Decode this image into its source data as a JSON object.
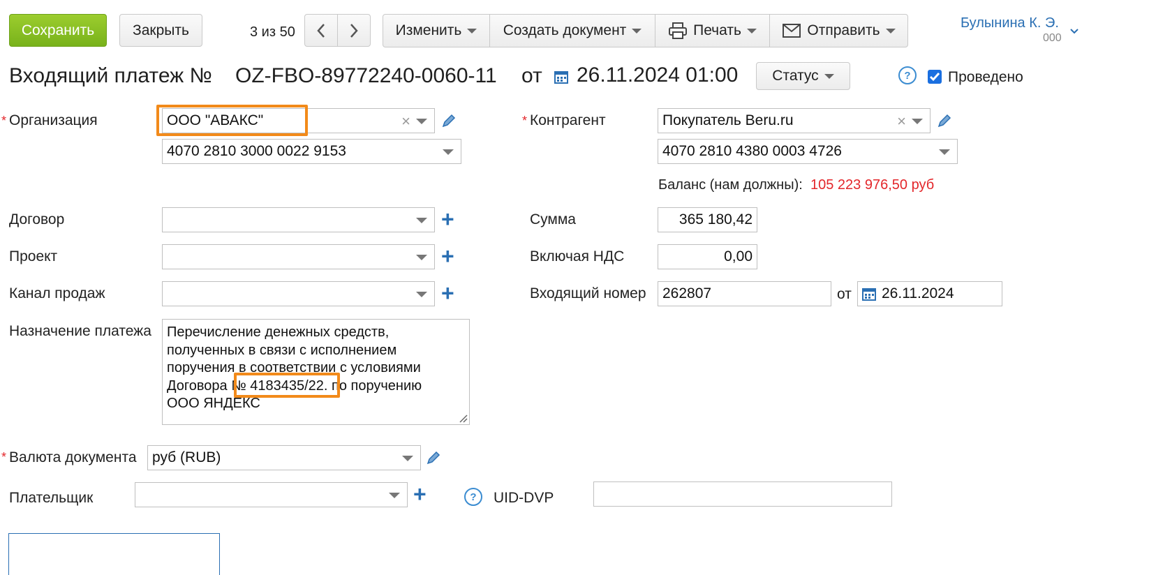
{
  "toolbar": {
    "save": "Сохранить",
    "close": "Закрыть",
    "pager": "3 из 50",
    "change": "Изменить",
    "create_doc": "Создать документ",
    "print": "Печать",
    "send": "Отправить"
  },
  "user": {
    "name": "Булынина К. Э.",
    "org": "000"
  },
  "title": {
    "prefix": "Входящий платеж №",
    "number": "OZ-FBO-89772240-0060-11",
    "from": "от",
    "date": "26.11.2024 01:00",
    "status_label": "Статус",
    "posted_label": "Проведено"
  },
  "form": {
    "organization": {
      "label": "Организация",
      "value": "ООО \"АВАКС\"",
      "account": "4070 2810 3000 0022 9153"
    },
    "counterparty": {
      "label": "Контрагент",
      "value": "Покупатель Beru.ru",
      "account": "4070 2810 4380 0003 4726"
    },
    "balance": {
      "label": "Баланс (нам должны):",
      "value": "105 223 976,50 руб"
    },
    "contract": {
      "label": "Договор",
      "value": ""
    },
    "project": {
      "label": "Проект",
      "value": ""
    },
    "sales_channel": {
      "label": "Канал продаж",
      "value": ""
    },
    "sum": {
      "label": "Сумма",
      "value": "365 180,42"
    },
    "vat": {
      "label": "Включая НДС",
      "value": "0,00"
    },
    "incoming_number": {
      "label": "Входящий номер",
      "value": "262807",
      "from": "от",
      "date": "26.11.2024"
    },
    "purpose": {
      "label": "Назначение платежа",
      "line1": "Перечисление денежных средств,",
      "line2": "полученных в связи с исполнением",
      "line3": "поручения в соответствии с условиями",
      "line4_pre": "Договора ",
      "line4_num": "№ 4183435/22.",
      "line4_post": " по поручению",
      "line5": "ООО ЯНДЕКС"
    },
    "currency": {
      "label": "Валюта документа",
      "value": "руб (RUB)"
    },
    "payer": {
      "label": "Плательщик",
      "value": ""
    },
    "uid": {
      "label": "UID-DVP",
      "value": ""
    }
  },
  "colors": {
    "accent": "#2a6fb3",
    "save": "#8cc026",
    "highlight": "#f28a1a",
    "negative": "#e3262a"
  }
}
